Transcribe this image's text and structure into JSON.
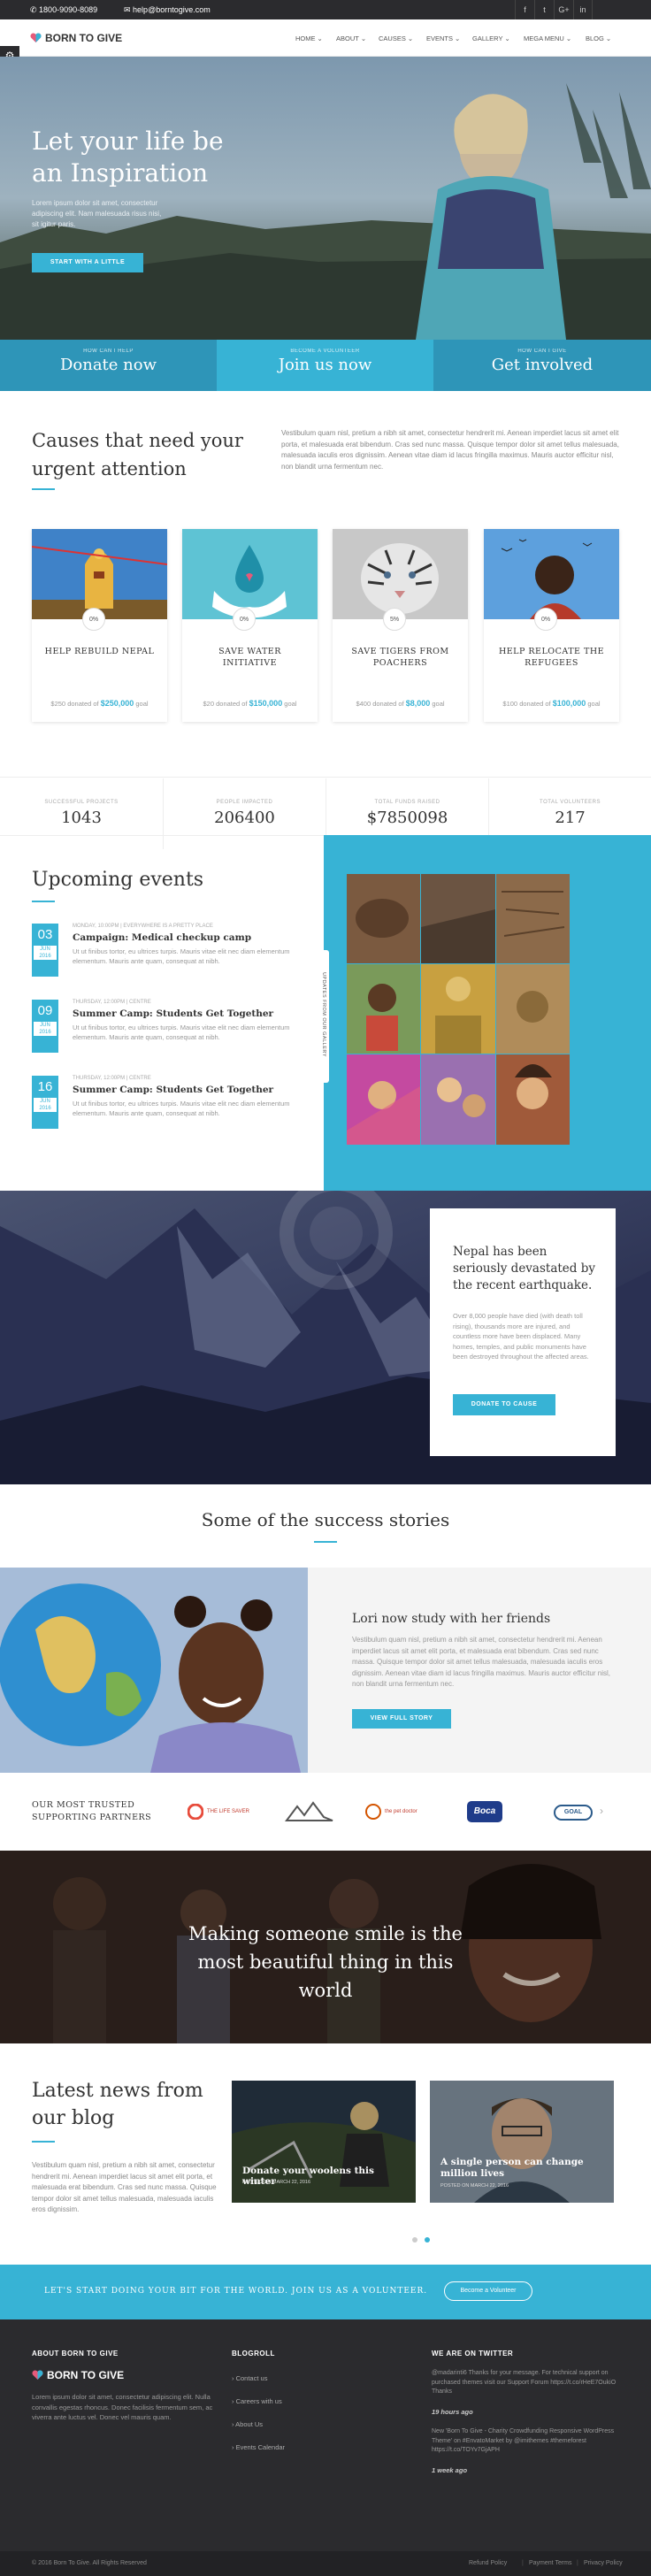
{
  "topbar": {
    "phone": "1800-9090-8089",
    "email": "help@borntogive.com",
    "social": [
      "f",
      "t",
      "G+",
      "in"
    ]
  },
  "brand": {
    "logo_text": "BORN TO GIVE",
    "accent": "#37b3d5"
  },
  "nav": {
    "items": [
      {
        "label": "HOME",
        "caret": "⌄"
      },
      {
        "label": "ABOUT",
        "caret": "⌄"
      },
      {
        "label": "CAUSES",
        "caret": "⌄"
      },
      {
        "label": "EVENTS",
        "caret": "⌄"
      },
      {
        "label": "GALLERY",
        "caret": "⌄"
      },
      {
        "label": "MEGA MENU",
        "caret": "⌄"
      },
      {
        "label": "BLOG",
        "caret": "⌄"
      }
    ]
  },
  "hero": {
    "title": "Let your life be an Inspiration",
    "text": "Lorem ipsum dolor sit amet, consectetur adipiscing elit. Nam malesuada risus nisi, sit igitur paris.",
    "button": "START WITH A LITTLE"
  },
  "cta": [
    {
      "small": "HOW CAN I HELP",
      "large": "Donate now"
    },
    {
      "small": "BECOME A VOLUNTEER",
      "large": "Join us now"
    },
    {
      "small": "HOW CAN I GIVE",
      "large": "Get involved"
    }
  ],
  "causes": {
    "title": "Causes that need your urgent attention",
    "text": "Vestibulum quam nisl, pretium a nibh sit amet, consectetur hendrerit mi. Aenean imperdiet lacus sit amet elit porta, et malesuada erat bibendum. Cras sed nunc massa. Quisque tempor dolor sit amet tellus malesuada, malesuada iaculis eros dignissim. Aenean vitae diam id lacus fringilla maximus. Mauris auctor efficitur nisl, non blandit urna fermentum nec.",
    "items": [
      {
        "title": "HELP REBUILD NEPAL",
        "badge": "0%",
        "donated": "$250 donated of",
        "goal": "$250,000",
        "suffix": "goal"
      },
      {
        "title": "SAVE WATER INITIATIVE",
        "badge": "0%",
        "donated": "$20 donated of",
        "goal": "$150,000",
        "suffix": "goal"
      },
      {
        "title": "SAVE TIGERS FROM POACHERS",
        "badge": "5%",
        "donated": "$400 donated of",
        "goal": "$8,000",
        "suffix": "goal"
      },
      {
        "title": "HELP RELOCATE THE REFUGEES",
        "badge": "0%",
        "donated": "$100 donated of",
        "goal": "$100,000",
        "suffix": "goal"
      }
    ]
  },
  "stats": [
    {
      "label": "SUCCESSFUL PROJECTS",
      "value": "1043"
    },
    {
      "label": "PEOPLE IMPACTED",
      "value": "206400"
    },
    {
      "label": "TOTAL FUNDS RAISED",
      "value": "$7850098"
    },
    {
      "label": "TOTAL VOLUNTEERS",
      "value": "217"
    }
  ],
  "events": {
    "title": "Upcoming events",
    "items": [
      {
        "day": "03",
        "month": "JUN 2016",
        "meta": "MONDAY, 10:00PM | EVERYWHERE IS A PRETTY PLACE",
        "title": "Campaign: Medical checkup camp",
        "text": "Ut ut finibus tortor, eu ultrices turpis. Mauris vitae elit nec diam elementum elementum. Mauris ante quam, consequat at nibh."
      },
      {
        "day": "09",
        "month": "JUN 2016",
        "meta": "THURSDAY, 12:00PM | CENTRE",
        "title": "Summer Camp: Students Get Together",
        "text": "Ut ut finibus tortor, eu ultrices turpis. Mauris vitae elit nec diam elementum elementum. Mauris ante quam, consequat at nibh."
      },
      {
        "day": "16",
        "month": "JUN 2016",
        "meta": "THURSDAY, 12:00PM | CENTRE",
        "title": "Summer Camp: Students Get Together",
        "text": "Ut ut finibus tortor, eu ultrices turpis. Mauris vitae elit nec diam elementum elementum. Mauris ante quam, consequat at nibh."
      }
    ],
    "gallery_tab": "UPDATES FROM OUR GALLERY"
  },
  "nepal": {
    "title": "Nepal has been seriously devastated by the recent earthquake.",
    "text": "Over 8,000 people have died (with death toll rising), thousands more are injured, and countless more have been displaced. Many homes, temples, and public monuments have been destroyed throughout the affected areas.",
    "button": "DONATE TO CAUSE"
  },
  "stories": {
    "title": "Some of the success stories",
    "story_title": "Lori now study with her friends",
    "story_text": "Vestibulum quam nisl, pretium a nibh sit amet, consectetur hendrerit mi. Aenean imperdiet lacus sit amet elit porta, et malesuada erat bibendum. Cras sed nunc massa. Quisque tempor dolor sit amet tellus malesuada, malesuada iaculis eros dignissim. Aenean vitae diam id lacus fringilla maximus. Mauris auctor efficitur nisl, non blandit urna fermentum nec.",
    "button": "VIEW FULL STORY"
  },
  "partners": {
    "title": "OUR MOST TRUSTED SUPPORTING PARTNERS",
    "logos": [
      "THE LIFE SAVER",
      "",
      "the pet doctor",
      "Boca",
      "GOAL"
    ],
    "next": "›"
  },
  "smile": {
    "text": "Making someone smile is the most beautiful thing in this world"
  },
  "news": {
    "title": "Latest news from our blog",
    "text": "Vestibulum quam nisl, pretium a nibh sit amet, consectetur hendrerit mi. Aenean imperdiet lacus sit amet elit porta, et malesuada erat bibendum. Cras sed nunc massa. Quisque tempor dolor sit amet tellus malesuada, malesuada iaculis eros dignissim.",
    "posts": [
      {
        "title": "Donate your woolens this winter",
        "date": "POSTED ON MARCH 22, 2016"
      },
      {
        "title": "A single person can change million lives",
        "date": "POSTED ON MARCH 22, 2016"
      }
    ]
  },
  "volunteer": {
    "text": "LET'S START DOING YOUR BIT FOR THE WORLD. JOIN US AS A VOLUNTEER.",
    "button": "Become a Volunteer"
  },
  "footer": {
    "about_title": "ABOUT BORN TO GIVE",
    "about_text": "Lorem ipsum dolor sit amet, consectetur adipiscing elit. Nulla convallis egestas rhoncus. Donec facilisis fermentum sem, ac viverra ante luctus vel. Donec vel mauris quam.",
    "blogroll_title": "BLOGROLL",
    "blogroll": [
      "Contact us",
      "Careers with us",
      "About Us",
      "Events Calendar"
    ],
    "twitter_title": "WE ARE ON TWITTER",
    "tweets": [
      {
        "text": "@madarinti6 Thanks for your message. For technical support on purchased themes visit our Support Forum https://t.co/rHeE7OukiO Thanks",
        "time": "19 hours ago"
      },
      {
        "text": "New 'Born To Give - Charity Crowdfunding Responsive WordPress Theme' on #EnvatoMarket by @imithemes #themeforest https://t.co/TOYv7GjAPH",
        "time": "1 week ago"
      }
    ]
  },
  "bottom": {
    "copyright": "© 2016 Born To Give. All Rights Reserved",
    "links": [
      "Refund Policy",
      "Payment Terms",
      "Privacy Policy"
    ]
  }
}
